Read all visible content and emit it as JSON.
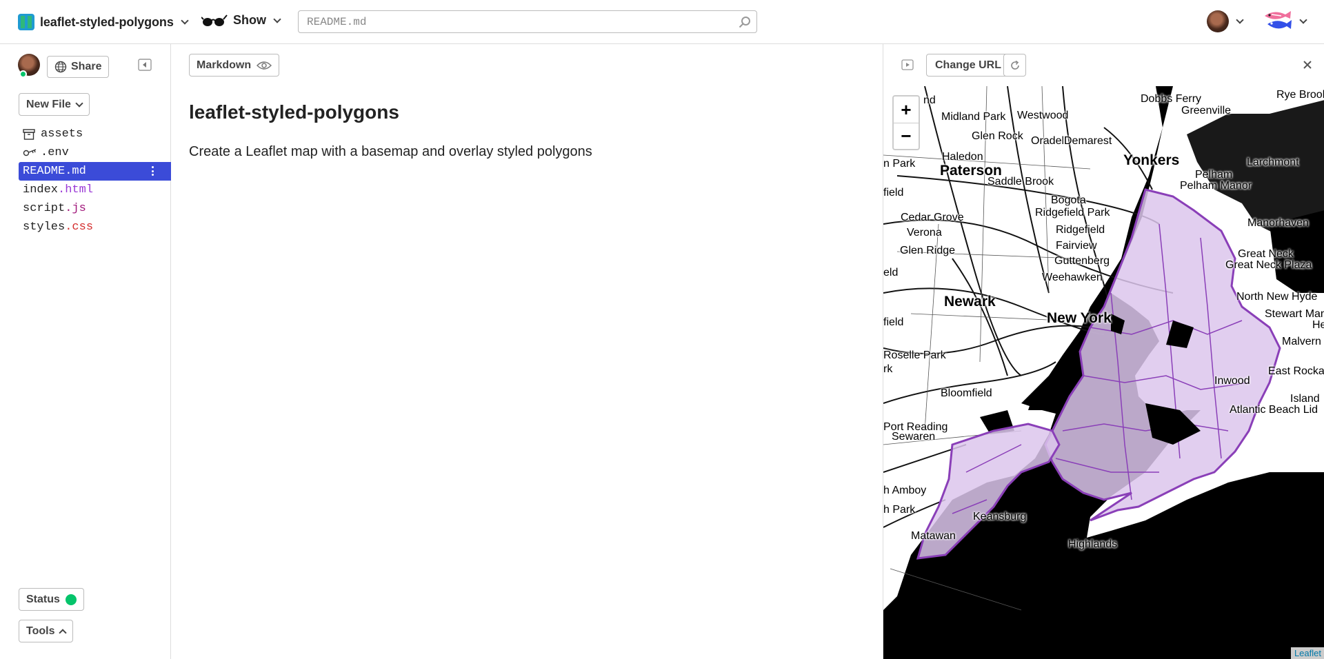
{
  "header": {
    "project_name": "leaflet-styled-polygons",
    "show_label": "Show",
    "search_placeholder": "README.md"
  },
  "sidebar": {
    "share_label": "Share",
    "new_file_label": "New File",
    "files": [
      {
        "base": "assets",
        "ext": "",
        "icon": "archive-icon"
      },
      {
        "base": ".env",
        "ext": "",
        "icon": "key-icon"
      },
      {
        "base": "README.md",
        "ext": "",
        "icon": "",
        "active": true
      },
      {
        "base": "index",
        "ext": ".html",
        "icon": ""
      },
      {
        "base": "script",
        "ext": ".js",
        "icon": ""
      },
      {
        "base": "styles",
        "ext": ".css",
        "icon": ""
      }
    ],
    "status_label": "Status",
    "tools_label": "Tools"
  },
  "editor": {
    "mode_label": "Markdown",
    "doc_title": "leaflet-styled-polygons",
    "doc_body": "Create a Leaflet map with a basemap and overlay styled polygons"
  },
  "preview": {
    "change_url_label": "Change URL",
    "zoom_in": "+",
    "zoom_out": "−",
    "attribution": "Leaflet",
    "map_labels": [
      {
        "text": "Dobbs Ferry",
        "big": false
      },
      {
        "text": "Rye Brook",
        "big": false
      },
      {
        "text": "Greenville",
        "big": false
      },
      {
        "text": "Midland Park",
        "big": false
      },
      {
        "text": "Westwood",
        "big": false
      },
      {
        "text": "Glen Rock",
        "big": false
      },
      {
        "text": "Oradell",
        "big": false
      },
      {
        "text": "Demarest",
        "big": false
      },
      {
        "text": "Haledon",
        "big": false
      },
      {
        "text": "Yonkers",
        "big": true
      },
      {
        "text": "Larchmont",
        "big": false
      },
      {
        "text": "Paterson",
        "big": true
      },
      {
        "text": "Saddle Brook",
        "big": false
      },
      {
        "text": "Pelham",
        "big": false
      },
      {
        "text": "Pelham Manor",
        "big": false
      },
      {
        "text": "Bogota",
        "big": false
      },
      {
        "text": "Ridgefield Park",
        "big": false
      },
      {
        "text": "Cedar Grove",
        "big": false
      },
      {
        "text": "Ridgefield",
        "big": false
      },
      {
        "text": "Manorhaven",
        "big": false
      },
      {
        "text": "Verona",
        "big": false
      },
      {
        "text": "Fairview",
        "big": false
      },
      {
        "text": "Glen Ridge",
        "big": false
      },
      {
        "text": "Guttenberg",
        "big": false
      },
      {
        "text": "Great Neck",
        "big": false
      },
      {
        "text": "Great Neck Plaza",
        "big": false
      },
      {
        "text": "Weehawken",
        "big": false
      },
      {
        "text": "North New Hyde",
        "big": false
      },
      {
        "text": "Newark",
        "big": true
      },
      {
        "text": "New York",
        "big": true
      },
      {
        "text": "Stewart Man",
        "big": false
      },
      {
        "text": "He",
        "big": false
      },
      {
        "text": "Malvern",
        "big": false
      },
      {
        "text": "Roselle Park",
        "big": false
      },
      {
        "text": "East Rocka",
        "big": false
      },
      {
        "text": "Inwood",
        "big": false
      },
      {
        "text": "Bloomfield",
        "big": false
      },
      {
        "text": "Island",
        "big": false
      },
      {
        "text": "Atlantic Beach Lid",
        "big": false
      },
      {
        "text": "Port Reading",
        "big": false
      },
      {
        "text": "Sewaren",
        "big": false
      },
      {
        "text": "h Amboy",
        "big": false
      },
      {
        "text": "h Park",
        "big": false
      },
      {
        "text": "Keansburg",
        "big": false
      },
      {
        "text": "Matawan",
        "big": false
      },
      {
        "text": "Highlands",
        "big": false
      },
      {
        "text": "nd",
        "big": false
      },
      {
        "text": "n Park",
        "big": false
      },
      {
        "text": "field",
        "big": false
      },
      {
        "text": "eld",
        "big": false
      },
      {
        "text": "field",
        "big": false
      },
      {
        "text": "rk",
        "big": false
      }
    ]
  },
  "colors": {
    "accent": "#3b4bd8",
    "status_green": "#05c46b",
    "polygon_fill": "#dcc6ec",
    "polygon_stroke": "#8a3fb8"
  }
}
